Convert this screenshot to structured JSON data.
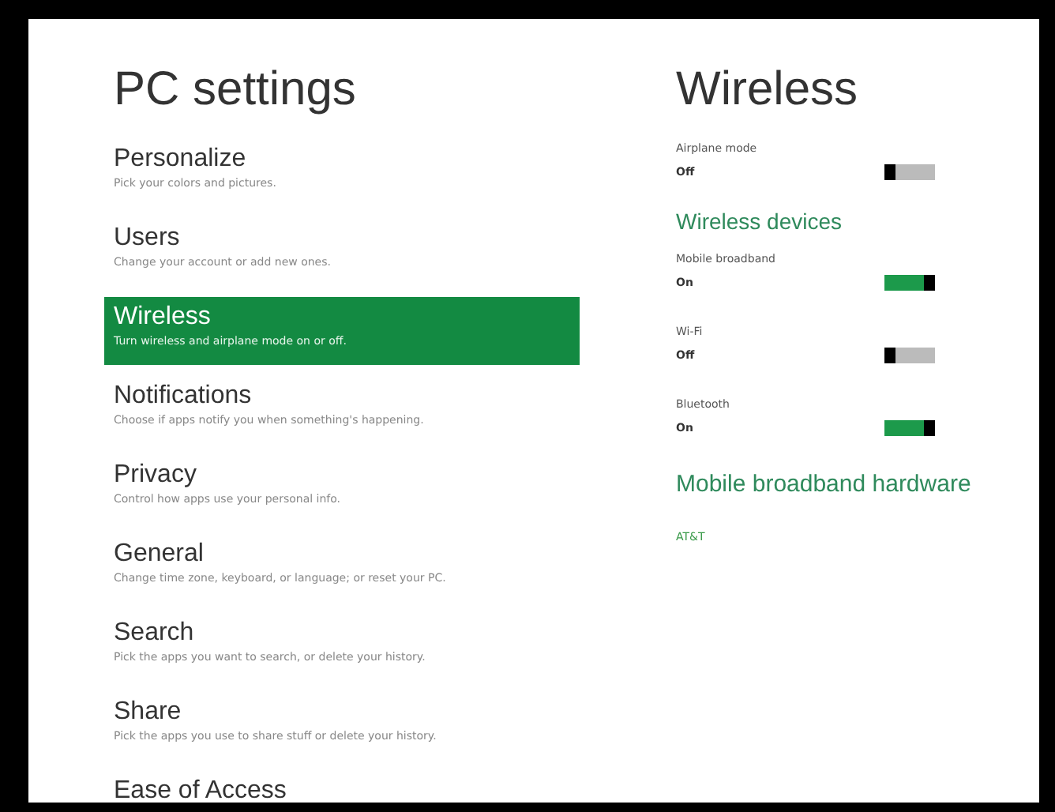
{
  "settings": {
    "title": "PC settings",
    "items": [
      {
        "title": "Personalize",
        "description": "Pick your colors and pictures.",
        "selected": false
      },
      {
        "title": "Users",
        "description": "Change your account or add new ones.",
        "selected": false
      },
      {
        "title": "Wireless",
        "description": "Turn wireless and airplane mode on or off.",
        "selected": true
      },
      {
        "title": "Notifications",
        "description": "Choose if apps notify you when something's happening.",
        "selected": false
      },
      {
        "title": "Privacy",
        "description": "Control how apps use your personal info.",
        "selected": false
      },
      {
        "title": "General",
        "description": "Change time zone, keyboard, or language; or reset your PC.",
        "selected": false
      },
      {
        "title": "Search",
        "description": "Pick the apps you want to search, or delete your history.",
        "selected": false
      },
      {
        "title": "Share",
        "description": "Pick the apps you use to share stuff or delete your history.",
        "selected": false
      },
      {
        "title": "Ease of Access",
        "selected": false
      }
    ]
  },
  "wireless": {
    "title": "Wireless",
    "airplane_mode": {
      "label": "Airplane mode",
      "state": "Off",
      "on": false
    },
    "devices_heading": "Wireless devices",
    "devices": [
      {
        "label": "Mobile broadband",
        "state": "On",
        "on": true
      },
      {
        "label": "Wi-Fi",
        "state": "Off",
        "on": false
      },
      {
        "label": "Bluetooth",
        "state": "On",
        "on": true
      }
    ],
    "hardware_heading": "Mobile broadband hardware",
    "hardware_link": "AT&T"
  }
}
